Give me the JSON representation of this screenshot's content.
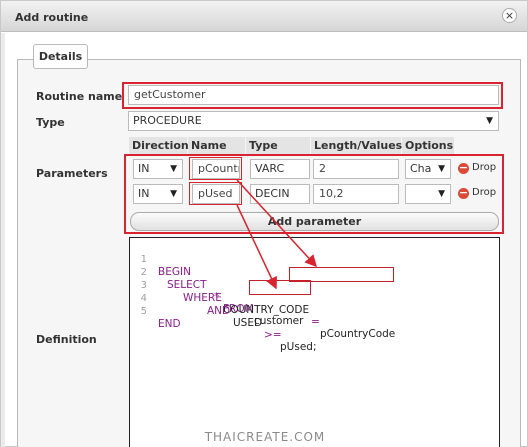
{
  "dialog": {
    "title": "Add routine"
  },
  "legend": "Details",
  "form": {
    "routine_name_label": "Routine name",
    "routine_name_value": "getCustomer",
    "type_label": "Type",
    "type_value": "PROCEDURE",
    "parameters_label": "Parameters",
    "definition_label": "Definition"
  },
  "param_headers": [
    "Direction",
    "Name",
    "Type",
    "Length/Values",
    "Options"
  ],
  "params": [
    {
      "direction": "IN",
      "name": "pCountry",
      "type": "VARC",
      "length": "2",
      "option": "Cha",
      "drop": "Drop"
    },
    {
      "direction": "IN",
      "name": "pUsed",
      "type": "DECIN",
      "length": "10,2",
      "option": "",
      "drop": "Drop"
    }
  ],
  "add_parameter": "Add parameter",
  "code": {
    "line_numbers": [
      "1",
      "2",
      "3",
      "4",
      "5"
    ],
    "begin": "BEGIN",
    "select": "SELECT",
    "star": "*",
    "from": "FROM",
    "table": "customer",
    "where": "WHERE",
    "col_country": "COUNTRY_CODE",
    "eq": "=",
    "p_country": "pCountryCode",
    "and": "AND",
    "col_used": "USED",
    "gte": ">=",
    "p_used": "pUsed;",
    "end": "END"
  },
  "footer": "THAICREATE.COM"
}
